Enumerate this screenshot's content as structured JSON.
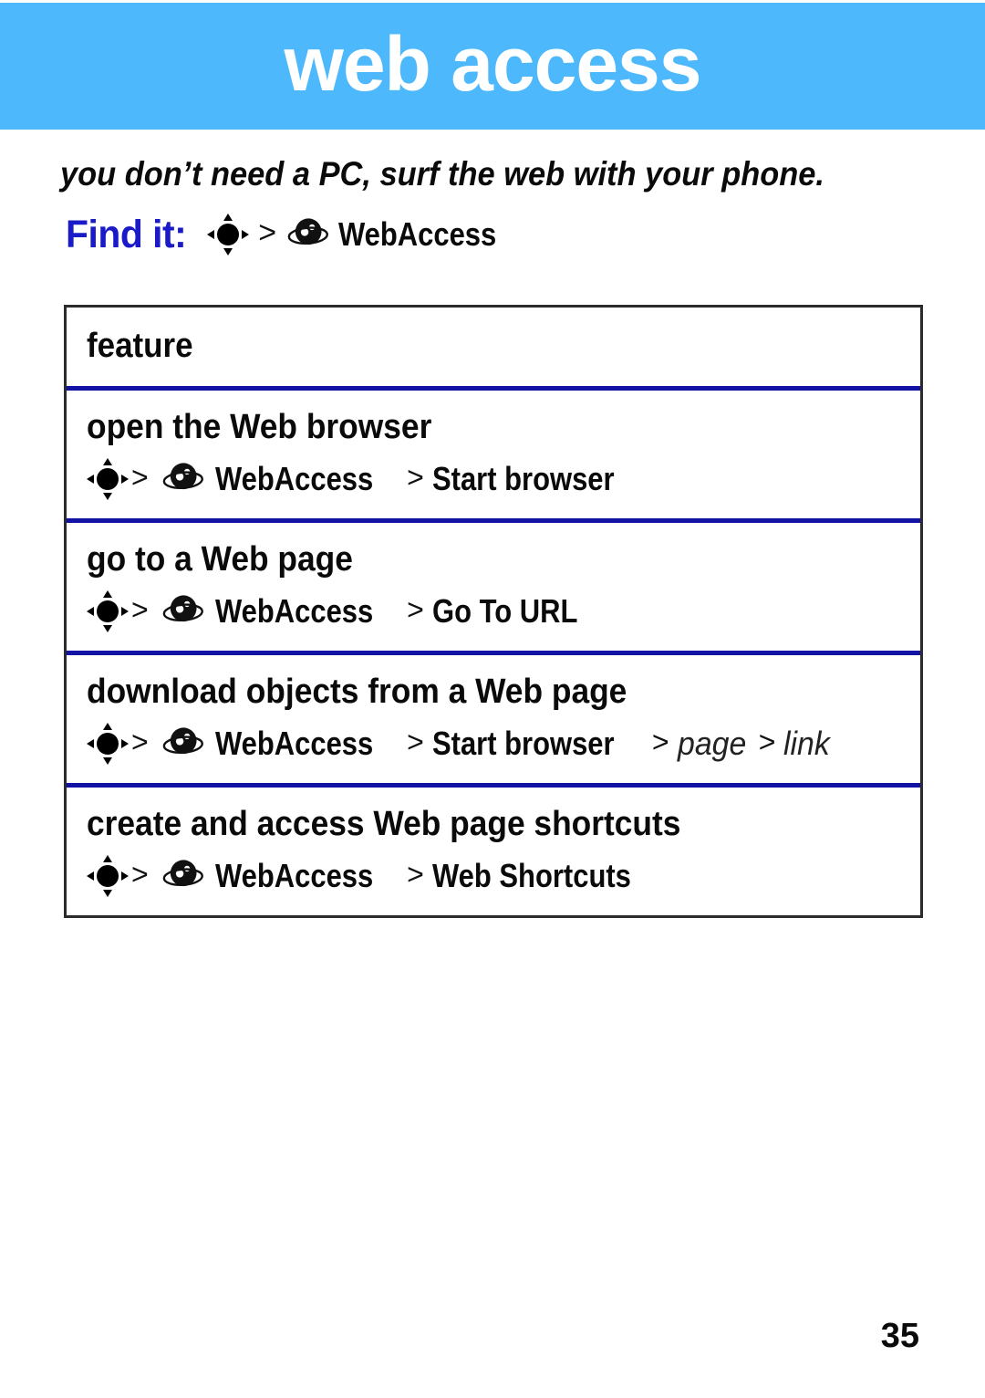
{
  "header": {
    "title": "web access",
    "background_color": "#4db8fb",
    "title_color": "#ffffff"
  },
  "subtitle": "you don’t need a PC, surf the web with your phone.",
  "find_it": {
    "label": "Find it:",
    "label_color": "#1a1ac8",
    "navkey_icon": "navigation-key-icon",
    "separator": ">",
    "globe_icon": "web-access-globe-icon",
    "menu": "WebAccess"
  },
  "table": {
    "border_color": "#2b2b2b",
    "separator_color": "#1313a3",
    "header": "feature",
    "rows": [
      {
        "title": "open the Web browser",
        "path": [
          {
            "type": "icon",
            "name": "navigation-key-icon"
          },
          {
            "type": "sep",
            "text": ">"
          },
          {
            "type": "icon",
            "name": "web-access-globe-icon"
          },
          {
            "type": "text",
            "text": "WebAccess"
          },
          {
            "type": "sep",
            "text": ">"
          },
          {
            "type": "text",
            "text": "Start browser"
          }
        ]
      },
      {
        "title": "go to a Web page",
        "path": [
          {
            "type": "icon",
            "name": "navigation-key-icon"
          },
          {
            "type": "sep",
            "text": ">"
          },
          {
            "type": "icon",
            "name": "web-access-globe-icon"
          },
          {
            "type": "text",
            "text": "WebAccess"
          },
          {
            "type": "sep",
            "text": ">"
          },
          {
            "type": "text",
            "text": "Go To URL"
          }
        ]
      },
      {
        "title": "download objects from a Web page",
        "path": [
          {
            "type": "icon",
            "name": "navigation-key-icon"
          },
          {
            "type": "sep",
            "text": ">"
          },
          {
            "type": "icon",
            "name": "web-access-globe-icon"
          },
          {
            "type": "text",
            "text": "WebAccess"
          },
          {
            "type": "sep",
            "text": ">"
          },
          {
            "type": "text",
            "text": "Start browser"
          },
          {
            "type": "sep",
            "text": ">"
          },
          {
            "type": "var",
            "text": "page"
          },
          {
            "type": "sep",
            "text": ">"
          },
          {
            "type": "var",
            "text": "link"
          }
        ]
      },
      {
        "title": "create and access Web page shortcuts",
        "path": [
          {
            "type": "icon",
            "name": "navigation-key-icon"
          },
          {
            "type": "sep",
            "text": ">"
          },
          {
            "type": "icon",
            "name": "web-access-globe-icon"
          },
          {
            "type": "text",
            "text": "WebAccess"
          },
          {
            "type": "sep",
            "text": ">"
          },
          {
            "type": "text",
            "text": "Web Shortcuts"
          }
        ]
      }
    ]
  },
  "page_number": "35"
}
